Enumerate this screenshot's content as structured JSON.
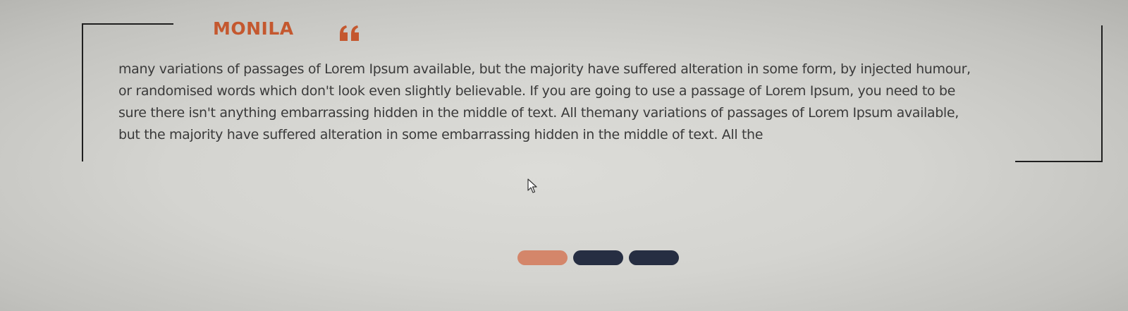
{
  "testimonial": {
    "author": "MONILA",
    "quote_icon": "quote-open-icon",
    "lines": [
      "many variations of passages of Lorem Ipsum available, but the majority have suffered alteration in some form, by injected humour,",
      "or randomised words which don't look even slightly believable. If you are going to use a passage of Lorem Ipsum, you need to be",
      "sure there isn't anything embarrassing hidden in the middle of text. All themany variations of passages of Lorem Ipsum available,",
      "but the majority have suffered alteration in some embarrassing hidden in the middle of text. All the"
    ]
  },
  "carousel": {
    "slide_count": 3,
    "active_index": 0
  },
  "colors": {
    "accent": "#c4582f",
    "active_dot": "#d4866a",
    "inactive_dot": "#262e42",
    "frame": "#1f1f1f",
    "text": "#3a3a3a"
  }
}
